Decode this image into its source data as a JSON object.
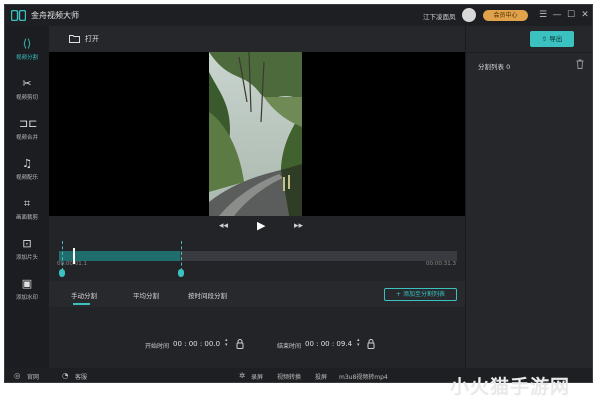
{
  "app": {
    "title": "金舟视频大师",
    "user_name": "江下凌面凤",
    "member_label": "会员中心"
  },
  "window_icons": {
    "menu": "menu-icon",
    "minimize": "minimize-icon",
    "maximize": "maximize-icon",
    "close": "close-icon"
  },
  "sidebar": {
    "items": [
      {
        "label": "视频分割",
        "icon": "split-icon",
        "active": true
      },
      {
        "label": "视频剪切",
        "icon": "scissors-icon"
      },
      {
        "label": "视频合并",
        "icon": "merge-icon"
      },
      {
        "label": "视频配乐",
        "icon": "music-icon"
      },
      {
        "label": "画面裁剪",
        "icon": "crop-icon"
      },
      {
        "label": "添加片头",
        "icon": "add-intro-icon"
      },
      {
        "label": "添加水印",
        "icon": "watermark-icon"
      }
    ]
  },
  "toolbar": {
    "open_label": "打开",
    "export_label": "导出"
  },
  "timeline": {
    "current_time": "00:00:01.1",
    "end_time": "00:00:31.3",
    "selection_end_fraction": 0.3
  },
  "split_tabs": [
    {
      "label": "手动分割",
      "active": true
    },
    {
      "label": "平均分割"
    },
    {
      "label": "按时间段分割"
    }
  ],
  "add_to_list_label": "+ 添加至分割列表",
  "time_fields": {
    "start_label": "开始时间",
    "start_value": "00 : 00 : 00.0",
    "end_label": "结束时间",
    "end_value": "00 : 00 : 09.4"
  },
  "split_list": {
    "title": "分割列表 0"
  },
  "statusbar": {
    "items": [
      {
        "label": "官网",
        "icon": "globe-icon"
      },
      {
        "label": "客服",
        "icon": "headset-icon"
      },
      {
        "label": "录屏",
        "icon": "record-icon"
      },
      {
        "label": "视频转换"
      },
      {
        "label": "投屏"
      },
      {
        "label": "m3u8视频转mp4"
      }
    ]
  },
  "watermark_text": "小火猫手游网",
  "colors": {
    "accent": "#3bc2c0",
    "background": "#232427",
    "member_badge": "#e0a24a"
  }
}
